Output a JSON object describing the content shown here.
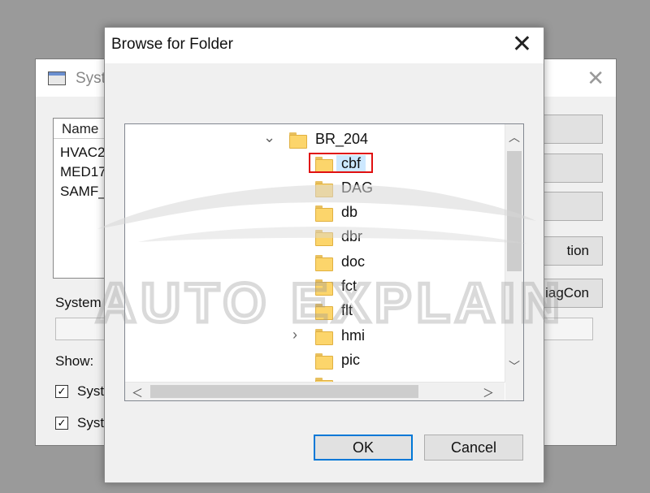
{
  "background_window": {
    "title": "Syst",
    "list_header": "Name",
    "list_items": [
      "HVAC2",
      "MED17",
      "SAMF_"
    ],
    "system_label": "System",
    "show_label": "Show:",
    "checkbox_1_label": "Syst",
    "checkbox_2_label": "Syst",
    "checkbox_1_checked": "✓",
    "checkbox_2_checked": "✓",
    "button_4_label": "tion",
    "button_5_label": "iagCon"
  },
  "dialog": {
    "title": "Browse for Folder",
    "close_glyph": "✕",
    "tree": {
      "parent": {
        "label": "BR_204",
        "expander": "⌄"
      },
      "children": [
        {
          "label": "cbf",
          "selected": true
        },
        {
          "label": "DAG"
        },
        {
          "label": "db"
        },
        {
          "label": "dbr"
        },
        {
          "label": "doc"
        },
        {
          "label": "fct"
        },
        {
          "label": "flt"
        },
        {
          "label": "hmi",
          "expander": "›"
        },
        {
          "label": "pic"
        }
      ]
    },
    "ok_label": "OK",
    "cancel_label": "Cancel"
  },
  "watermark": {
    "text": "AUTO EXPLAIN"
  },
  "colors": {
    "selection": "#cce8ff",
    "highlight_box": "#e01010",
    "primary_border": "#0078d7"
  }
}
